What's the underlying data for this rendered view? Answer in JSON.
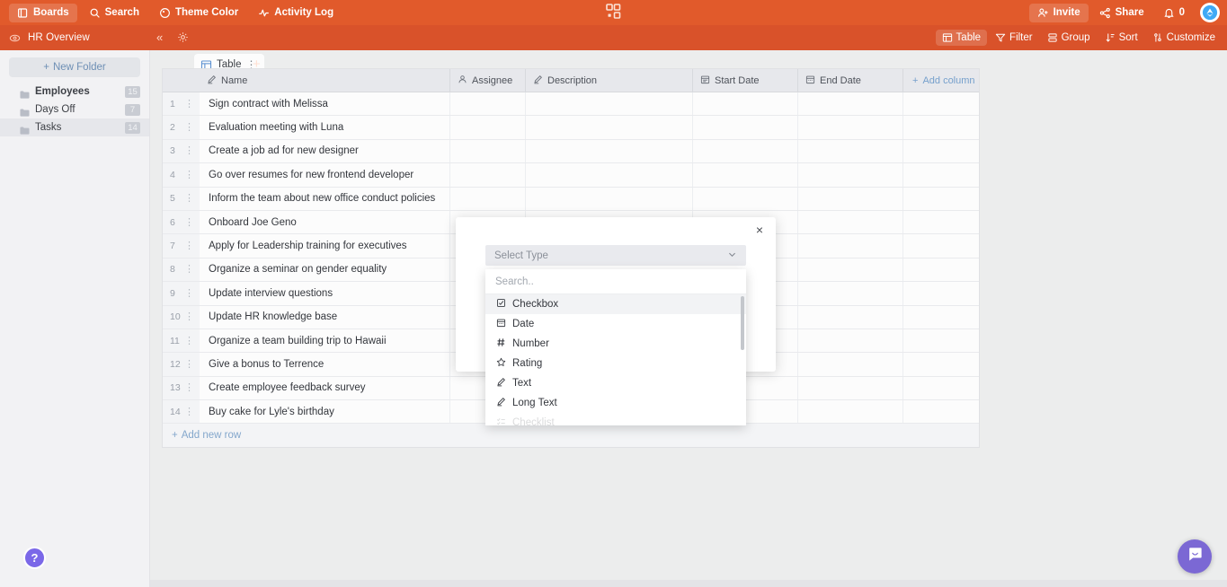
{
  "topbar": {
    "items": [
      {
        "label": "Boards",
        "icon": "boards-icon"
      },
      {
        "label": "Search",
        "icon": "search-icon"
      },
      {
        "label": "Theme Color",
        "icon": "palette-icon"
      },
      {
        "label": "Activity Log",
        "icon": "activity-icon"
      }
    ],
    "right": [
      {
        "label": "Invite",
        "icon": "invite-icon"
      },
      {
        "label": "Share",
        "icon": "share-icon"
      },
      {
        "label": "0",
        "icon": "bell-icon"
      }
    ],
    "brand": "logo-icon",
    "accent": "#e15a2b"
  },
  "subbar": {
    "board_name": "HR Overview",
    "collapse": "«",
    "tab": {
      "label": "Table",
      "menu": "⋮",
      "plus": "+"
    },
    "view_tools": [
      {
        "label": "Table",
        "icon": "table-icon",
        "active": true
      },
      {
        "label": "Filter",
        "icon": "filter-icon",
        "active": false
      },
      {
        "label": "Group",
        "icon": "group-icon",
        "active": false
      },
      {
        "label": "Sort",
        "icon": "sort-icon",
        "active": false
      },
      {
        "label": "Customize",
        "icon": "customize-icon",
        "active": false
      }
    ],
    "accent": "#d9522a"
  },
  "sidebar": {
    "new_folder": "New Folder",
    "new_folder_plus": "+",
    "folders": [
      {
        "name": "Employees",
        "count": "15",
        "selected": false,
        "bold": true
      },
      {
        "name": "Days Off",
        "count": "7",
        "selected": false,
        "bold": false
      },
      {
        "name": "Tasks",
        "count": "14",
        "selected": true,
        "bold": false
      }
    ],
    "help": "?"
  },
  "table": {
    "columns": [
      {
        "label": "",
        "icon": "",
        "key": "idx"
      },
      {
        "label": "Name",
        "icon": "pencil-icon",
        "key": "name"
      },
      {
        "label": "Assignee",
        "icon": "person-icon",
        "key": "assignee"
      },
      {
        "label": "Description",
        "icon": "pencil-icon",
        "key": "description"
      },
      {
        "label": "Start Date",
        "icon": "calendar-icon",
        "key": "start_date"
      },
      {
        "label": "End Date",
        "icon": "calendar-icon",
        "key": "end_date"
      }
    ],
    "add_column": "Add column",
    "add_column_plus": "+",
    "add_row": "Add new row",
    "add_row_plus": "+",
    "rows": [
      {
        "n": "1",
        "name": "Sign contract with Melissa",
        "assignee": "",
        "description": "",
        "start_date": "",
        "end_date": ""
      },
      {
        "n": "2",
        "name": "Evaluation meeting with Luna",
        "assignee": "",
        "description": "",
        "start_date": "",
        "end_date": ""
      },
      {
        "n": "3",
        "name": "Create a job ad for new designer",
        "assignee": "",
        "description": "",
        "start_date": "",
        "end_date": ""
      },
      {
        "n": "4",
        "name": "Go over resumes for new frontend developer",
        "assignee": "",
        "description": "",
        "start_date": "",
        "end_date": ""
      },
      {
        "n": "5",
        "name": "Inform the team about new office conduct policies",
        "assignee": "",
        "description": "",
        "start_date": "",
        "end_date": ""
      },
      {
        "n": "6",
        "name": "Onboard Joe Geno",
        "assignee": "",
        "description": "",
        "start_date": "",
        "end_date": ""
      },
      {
        "n": "7",
        "name": "Apply for Leadership training for executives",
        "assignee": "",
        "description": "",
        "start_date": "",
        "end_date": ""
      },
      {
        "n": "8",
        "name": "Organize a seminar on gender equality",
        "assignee": "",
        "description": "",
        "start_date": "",
        "end_date": ""
      },
      {
        "n": "9",
        "name": "Update interview questions",
        "assignee": "",
        "description": "",
        "start_date": "",
        "end_date": ""
      },
      {
        "n": "10",
        "name": "Update HR knowledge base",
        "assignee": "",
        "description": "",
        "start_date": "",
        "end_date": ""
      },
      {
        "n": "11",
        "name": "Organize a team building trip to Hawaii",
        "assignee": "",
        "description": "",
        "start_date": "",
        "end_date": ""
      },
      {
        "n": "12",
        "name": "Give a bonus to Terrence",
        "assignee": "",
        "description": "",
        "start_date": "",
        "end_date": ""
      },
      {
        "n": "13",
        "name": "Create employee feedback survey",
        "assignee": "",
        "description": "",
        "start_date": "",
        "end_date": ""
      },
      {
        "n": "14",
        "name": "Buy cake for Lyle's birthday",
        "assignee": "",
        "description": "",
        "start_date": "",
        "end_date": ""
      }
    ]
  },
  "modal": {
    "close": "×",
    "select_type_label": "Select Type",
    "chevron": "⌄",
    "search_placeholder": "Search..",
    "search_value": "",
    "options": [
      {
        "label": "Checkbox",
        "icon": "checkbox-icon",
        "highlighted": true
      },
      {
        "label": "Date",
        "icon": "calendar-icon",
        "highlighted": false
      },
      {
        "label": "Number",
        "icon": "hash-icon",
        "highlighted": false
      },
      {
        "label": "Rating",
        "icon": "star-icon",
        "highlighted": false
      },
      {
        "label": "Text",
        "icon": "pencil-icon",
        "highlighted": false
      },
      {
        "label": "Long Text",
        "icon": "pencil-icon",
        "highlighted": false
      },
      {
        "label": "Checklist",
        "icon": "checklist-icon",
        "highlighted": false
      }
    ]
  },
  "intercom": {
    "icon": "chat-icon",
    "color": "#7b68d4"
  }
}
